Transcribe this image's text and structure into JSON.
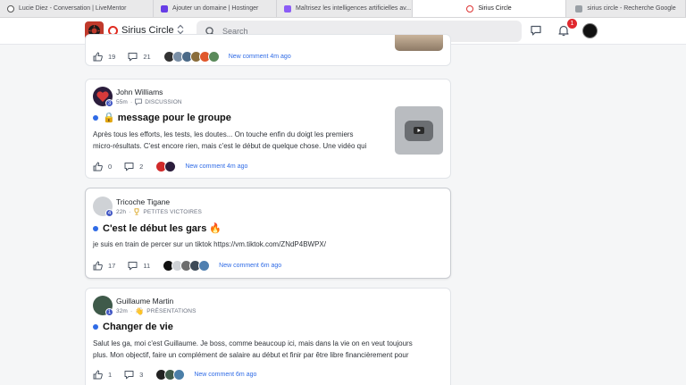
{
  "browser": {
    "tabs": [
      {
        "label": "Lucie Diez - Conversation | LiveMentor",
        "icon": "clock-icon"
      },
      {
        "label": "Ajouter un domaine | Hostinger",
        "icon": "hostinger-icon"
      },
      {
        "label": "Maîtrisez les intelligences artificielles av...",
        "icon": "purple-app-icon"
      },
      {
        "label": "Sirius Circle",
        "icon": "sirius-icon"
      },
      {
        "label": "sirius circle - Recherche Google",
        "icon": "google-icon"
      }
    ]
  },
  "header": {
    "brand": "Sirius Circle",
    "search_placeholder": "Search",
    "notification_count": "1"
  },
  "posts": [
    {
      "partial": true,
      "likes": "19",
      "comments": "21",
      "new_comment": "New comment 4m ago"
    },
    {
      "author": "John Williams",
      "level": "3",
      "time": "55m",
      "category": "DISCUSSION",
      "category_icon": "speech-bubble",
      "title": "🔒 message pour le groupe",
      "body_lines": [
        "Après tous les efforts, les tests, les doutes... On touche enfin du doigt les premiers",
        "micro-résultats. C'est encore rien, mais c'est le début de quelque chose. Une vidéo qui"
      ],
      "likes": "0",
      "comments": "2",
      "new_comment": "New comment 4m ago",
      "has_video_thumbnail": true
    },
    {
      "author": "Tricoche Tigane",
      "level": "4",
      "time": "22h",
      "category": "PETITES VICTOIRES",
      "category_icon": "trophy",
      "title": "C'est le début les gars 🔥",
      "body_lines": [
        "je suis en train de percer sur un tiktok https://vm.tiktok.com/ZNdP4BWPX/"
      ],
      "likes": "17",
      "comments": "11",
      "new_comment": "New comment 6m ago"
    },
    {
      "author": "Guillaume Martin",
      "level": "1",
      "time": "32m",
      "category": "PRÉSENTATIONS",
      "category_icon": "waving-hand",
      "title": "Changer de vie",
      "body_lines": [
        "Salut les ga, moi c'est Guillaume. Je boss, comme beaucoup ici, mais dans la vie on en veut toujours",
        "plus. Mon objectif, faire un complément de salaire au début et finir par être libre financièrement pour"
      ],
      "likes": "1",
      "comments": "3",
      "new_comment": "New comment 6m ago"
    }
  ],
  "colors": {
    "accent": "#2f6be6",
    "brand_red": "#e02b20",
    "notification_red": "#e0282e",
    "level_badge": "#4257c4"
  }
}
